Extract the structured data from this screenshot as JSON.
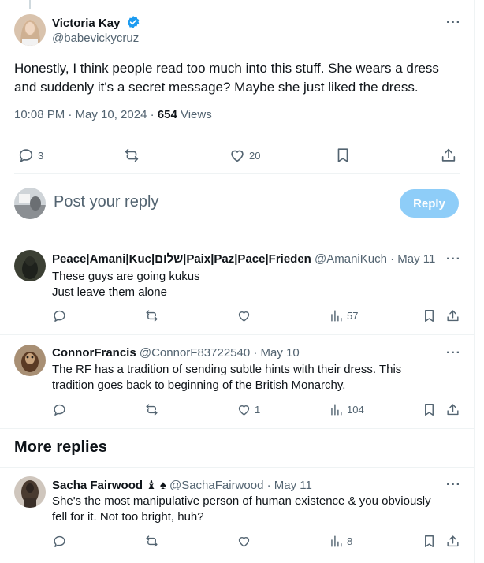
{
  "main": {
    "author_name": "Victoria Kay",
    "author_handle": "@babevickycruz",
    "text": "Honestly, I think people read too much into this stuff. She wears a dress and suddenly it's a secret message? Maybe she just liked the dress.",
    "time": "10:08 PM · May 10, 2024 · ",
    "views_count": "654",
    "views_label": " Views",
    "replies": "3",
    "likes": "20",
    "more": "···"
  },
  "compose": {
    "placeholder": "Post your reply",
    "button": "Reply"
  },
  "replies": [
    {
      "name": "Peace|Amani|Kuc|שלום|Paix|Paz|Pace|Frieden",
      "handle": "@AmaniKuch",
      "date": "· May 11",
      "text": [
        "These guys are going kukus",
        "Just leave them alone"
      ],
      "replies": "",
      "likes": "",
      "views": "57",
      "more": "···"
    },
    {
      "name": "ConnorFrancis",
      "handle": "@ConnorF83722540",
      "date": "· May 10",
      "text": [
        "The RF has a tradition of sending subtle hints with their dress.  This",
        "tradition goes back to beginning of the British Monarchy."
      ],
      "replies": "",
      "likes": "1",
      "views": "104",
      "more": "···"
    },
    {
      "name": "Sacha Fairwood",
      "name_suffix": "♝ ♠",
      "handle": "@SachaFairwood",
      "date": "· May 11",
      "text": [
        "She's the most manipulative person of human existence & you  obviously",
        "fell for it. Not too bright, huh?"
      ],
      "replies": "",
      "likes": "",
      "views": "8",
      "more": "···"
    }
  ],
  "section": {
    "more_replies": "More replies"
  },
  "colors": {
    "accent": "#1d9bf0",
    "reply_button_disabled": "#8ecdf8",
    "muted": "#536471",
    "text": "#0f1419",
    "border": "#eff3f4"
  }
}
